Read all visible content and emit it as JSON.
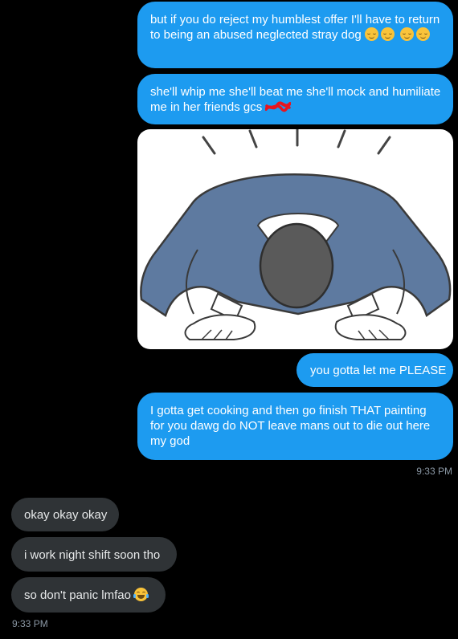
{
  "messages": {
    "m1": {
      "text": "but if you do reject my humblest offer I'll have to return to being an abused neglected stray dog",
      "emoji": [
        "relieved-face-icon",
        "relieved-face-icon",
        "relieved-face-icon",
        "relieved-face-icon"
      ]
    },
    "m2": {
      "text": "she'll whip me she'll beat me she'll mock and humiliate me in her friends gcs",
      "redaction": "red-scribble"
    },
    "image": {
      "description_icon": "bowing-person-illustration"
    },
    "m3": {
      "text": "you gotta let me PLEASE"
    },
    "m4": {
      "text": "I gotta get cooking and then go finish THAT painting for you dawg do NOT leave mans out to die out here my god"
    },
    "time_sent": "9:33 PM",
    "r1": {
      "text": "okay okay okay"
    },
    "r2": {
      "text": "i work night shift soon tho"
    },
    "r3": {
      "text": "so don't panic lmfao",
      "emoji": "face-with-tears-of-joy-icon"
    },
    "time_received": "9:33 PM"
  },
  "colors": {
    "background": "#000000",
    "sent_bubble": "#1d9bf0",
    "received_bubble": "#2f3336",
    "timestamp": "#8b98a5"
  }
}
